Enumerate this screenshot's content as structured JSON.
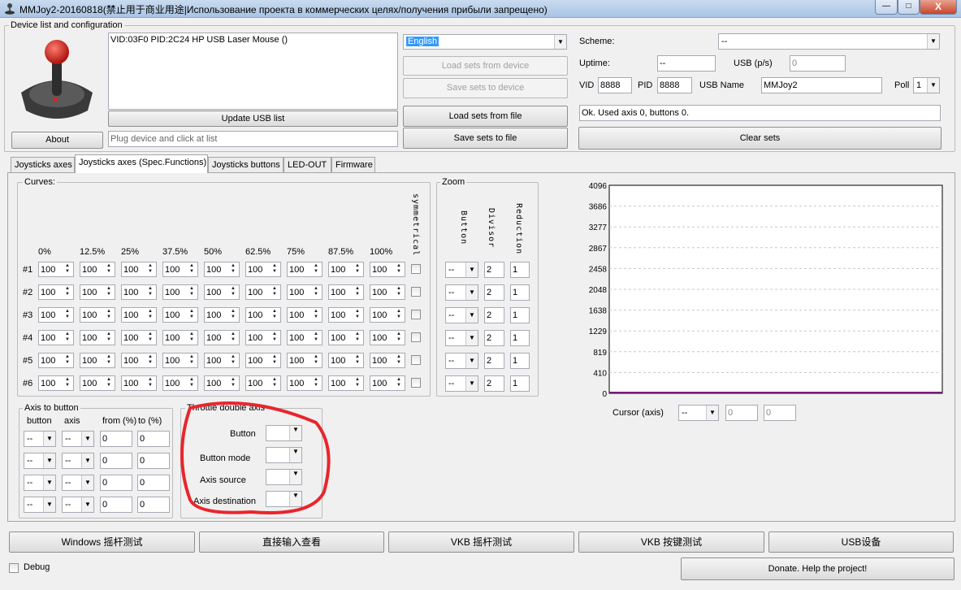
{
  "window": {
    "title": "MMJoy2-20160818(禁止用于商业用途|Использование проекта в коммерческих целях/получения прибыли запрещено)",
    "minimize": "—",
    "maximize": "□",
    "close": "X"
  },
  "device_group": {
    "label": "Device list and configuration",
    "device_list": [
      "VID:03F0 PID:2C24 HP USB Laser Mouse ()"
    ],
    "update_usb": "Update USB list",
    "about": "About",
    "status_placeholder": "Plug device and click at list",
    "language": "English",
    "load_from_device": "Load sets from device",
    "save_to_device": "Save sets to device",
    "load_from_file": "Load sets from file",
    "save_to_file": "Save sets to file",
    "scheme_label": "Scheme:",
    "scheme_value": "--",
    "uptime_label": "Uptime:",
    "uptime_value": "--",
    "usb_ps_label": "USB (p/s)",
    "usb_ps_value": "0",
    "vid_label": "VID",
    "vid_value": "8888",
    "pid_label": "PID",
    "pid_value": "8888",
    "usb_name_label": "USB Name",
    "usb_name_value": "MMJoy2",
    "poll_label": "Poll",
    "poll_value": "1",
    "message": "Ok. Used axis  0, buttons 0.",
    "clear_sets": "Clear sets"
  },
  "tabs": [
    "Joysticks axes",
    "Joysticks axes (Spec.Functions)",
    "Joysticks buttons",
    "LED-OUT",
    "Firmware"
  ],
  "curves": {
    "label": "Curves:",
    "headers": [
      "0%",
      "12.5%",
      "25%",
      "37.5%",
      "50%",
      "62.5%",
      "75%",
      "87.5%",
      "100%"
    ],
    "symmetrical": "symmetrical",
    "rows": [
      {
        "label": "#1",
        "values": [
          "100",
          "100",
          "100",
          "100",
          "100",
          "100",
          "100",
          "100",
          "100"
        ]
      },
      {
        "label": "#2",
        "values": [
          "100",
          "100",
          "100",
          "100",
          "100",
          "100",
          "100",
          "100",
          "100"
        ]
      },
      {
        "label": "#3",
        "values": [
          "100",
          "100",
          "100",
          "100",
          "100",
          "100",
          "100",
          "100",
          "100"
        ]
      },
      {
        "label": "#4",
        "values": [
          "100",
          "100",
          "100",
          "100",
          "100",
          "100",
          "100",
          "100",
          "100"
        ]
      },
      {
        "label": "#5",
        "values": [
          "100",
          "100",
          "100",
          "100",
          "100",
          "100",
          "100",
          "100",
          "100"
        ]
      },
      {
        "label": "#6",
        "values": [
          "100",
          "100",
          "100",
          "100",
          "100",
          "100",
          "100",
          "100",
          "100"
        ]
      }
    ]
  },
  "zoom": {
    "label": "Zoom",
    "headers": [
      "Button",
      "Divisor",
      "Reduction"
    ],
    "rows": [
      {
        "button": "--",
        "divisor": "2",
        "reduction": "1"
      },
      {
        "button": "--",
        "divisor": "2",
        "reduction": "1"
      },
      {
        "button": "--",
        "divisor": "2",
        "reduction": "1"
      },
      {
        "button": "--",
        "divisor": "2",
        "reduction": "1"
      },
      {
        "button": "--",
        "divisor": "2",
        "reduction": "1"
      },
      {
        "button": "--",
        "divisor": "2",
        "reduction": "1"
      }
    ]
  },
  "axis_to_button": {
    "label": "Axis to button",
    "headers": [
      "button",
      "axis",
      "from (%)",
      "to (%)"
    ],
    "rows": [
      {
        "button": "--",
        "axis": "--",
        "from": "0",
        "to": "0"
      },
      {
        "button": "--",
        "axis": "--",
        "from": "0",
        "to": "0"
      },
      {
        "button": "--",
        "axis": "--",
        "from": "0",
        "to": "0"
      },
      {
        "button": "--",
        "axis": "--",
        "from": "0",
        "to": "0"
      }
    ]
  },
  "throttle": {
    "label": "Throttle double axis",
    "button": "Button",
    "button_mode": "Button mode",
    "axis_source": "Axis source",
    "axis_destination": "Axis destination",
    "highlight_color": "#e8262b"
  },
  "chart_data": {
    "type": "line",
    "yticks": [
      "4096",
      "3686",
      "3277",
      "2867",
      "2458",
      "2048",
      "1638",
      "1229",
      "819",
      "410",
      "0"
    ],
    "ylim": [
      0,
      4096
    ],
    "grid": true,
    "series": [
      {
        "values": [
          0,
          0
        ]
      }
    ],
    "line_color": "#7a1a7a"
  },
  "cursor": {
    "label": "Cursor (axis)",
    "select": "--",
    "value1": "0",
    "value2": "0"
  },
  "bottom": {
    "buttons": [
      "Windows 摇杆测试",
      "直接输入查看",
      "VKB 摇杆测试",
      "VKB 按键测试",
      "USB设备"
    ],
    "debug": "Debug",
    "donate": "Donate. Help the project!"
  }
}
